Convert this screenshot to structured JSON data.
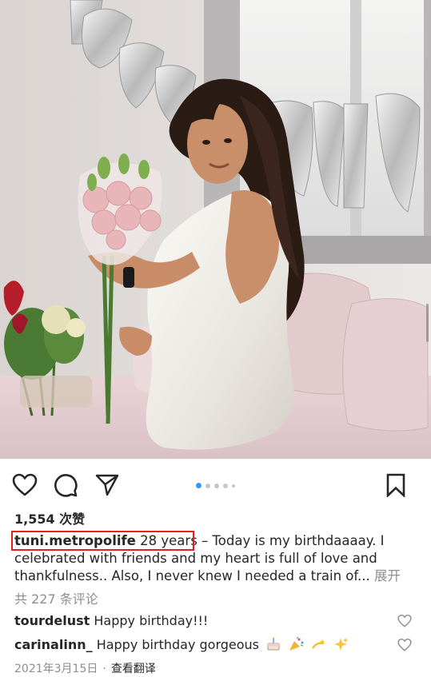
{
  "post": {
    "likes": "1,554 次赞",
    "username": "tuni.metropolife",
    "caption_highlight": "28 years",
    "caption_body": " – Today is my birthdaaaay. I celebrated with friends and my heart is full of love and thankfulness.. Also, I never knew I needed a train of...",
    "expand_label": "展开",
    "view_comments": "共 227 条评论",
    "date": "2021年3月15日",
    "separator": "·",
    "translate_label": "查看翻译"
  },
  "comments": [
    {
      "username": "tourdelust",
      "text": "Happy birthday!!!"
    },
    {
      "username": "carinalinn_",
      "text": "Happy birthday gorgeous"
    }
  ],
  "carousel": {
    "total_dots": 5,
    "active_index": 0
  },
  "icons": {
    "like": "heart-icon",
    "comment": "comment-bubble-icon",
    "share": "paper-plane-icon",
    "save": "bookmark-icon"
  },
  "colors": {
    "highlight_border": "#e2211c",
    "carousel_active": "#3897f0",
    "muted_text": "#8e8e8e"
  }
}
